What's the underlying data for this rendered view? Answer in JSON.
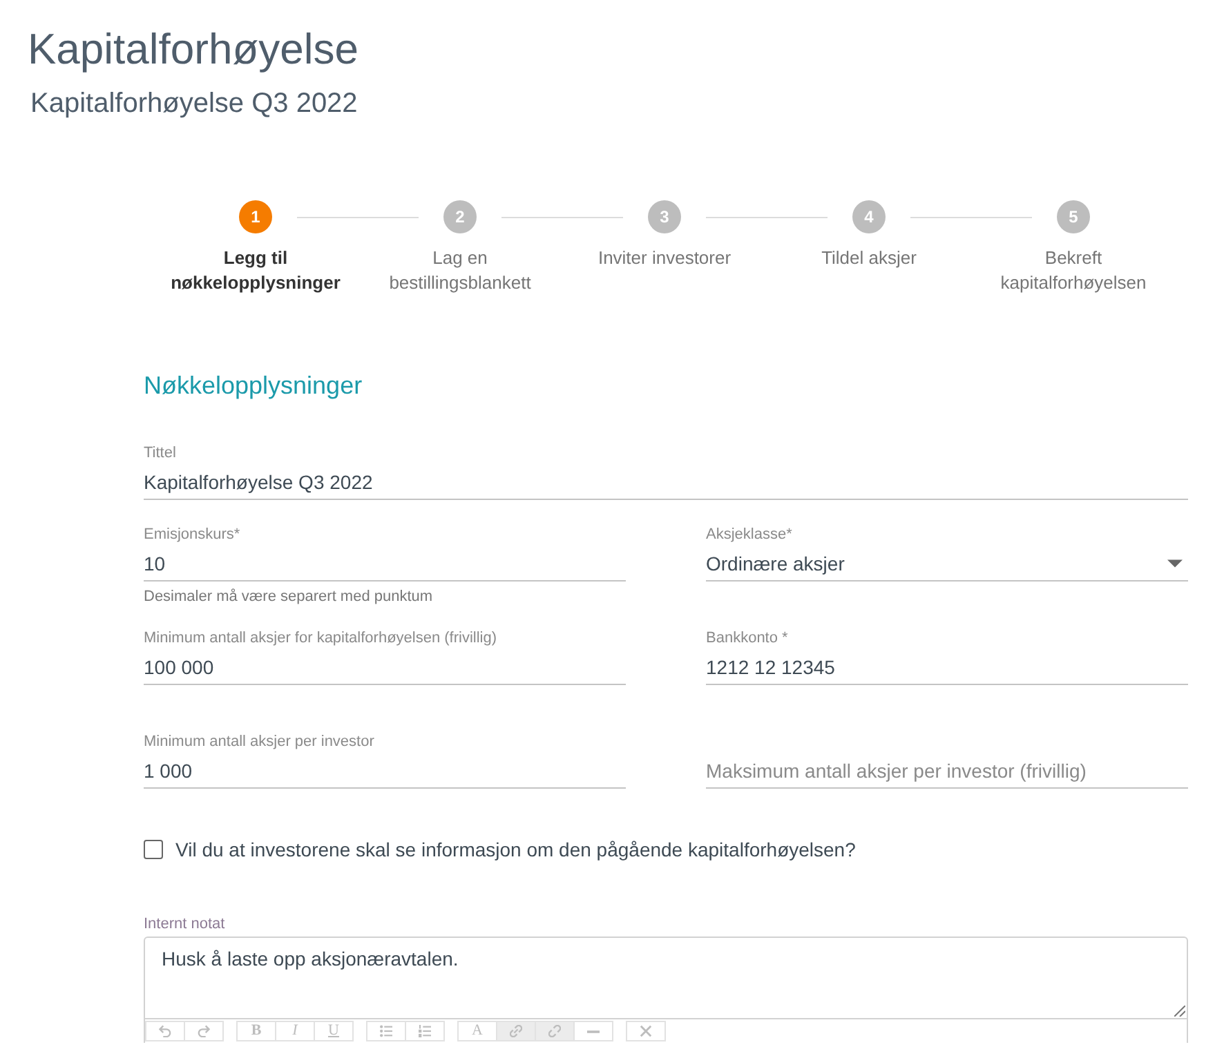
{
  "page": {
    "title": "Kapitalforhøyelse",
    "subtitle": "Kapitalforhøyelse Q3 2022"
  },
  "steps": [
    {
      "number": "1",
      "label": "Legg til nøkkelopplysninger",
      "selected": true
    },
    {
      "number": "2",
      "label": "Lag en bestillingsblankett",
      "selected": false
    },
    {
      "number": "3",
      "label": "Inviter investorer",
      "selected": false
    },
    {
      "number": "4",
      "label": "Tildel aksjer",
      "selected": false
    },
    {
      "number": "5",
      "label": "Bekreft kapitalforhøyelsen",
      "selected": false
    }
  ],
  "section": {
    "title": "Nøkkelopplysninger"
  },
  "form_rows": [
    {
      "fields": [
        {
          "kind": "text",
          "label": "Tittel",
          "value": "Kapitalforhøyelse Q3 2022"
        }
      ]
    },
    {
      "fields": [
        {
          "kind": "text",
          "label": "Emisjonskurs*",
          "value": "10",
          "helper": "Desimaler må være separert med punktum"
        },
        {
          "kind": "select",
          "label": "Aksjeklasse*",
          "value": "Ordinære aksjer"
        }
      ]
    },
    {
      "fields": [
        {
          "kind": "text",
          "label": "Minimum antall aksjer for kapitalforhøyelsen (frivillig)",
          "value": "100 000"
        },
        {
          "kind": "text",
          "label": "Bankkonto *",
          "value": "1212 12 12345"
        }
      ]
    },
    {
      "fields": [
        {
          "kind": "text",
          "label": "Minimum antall aksjer per investor",
          "value": "1 000"
        },
        {
          "kind": "text",
          "placeholder": "Maksimum antall aksjer per investor (frivillig)"
        }
      ]
    }
  ],
  "checkbox": {
    "label": "Vil du at investorene skal se informasjon om den pågående kapitalforhøyelsen?",
    "checked": false
  },
  "note": {
    "label": "Internt notat",
    "value": "Husk å laste opp aksjonæravtalen.",
    "toolbar": [
      {
        "buttons": [
          {
            "kind": "undo",
            "disabled": false
          },
          {
            "kind": "redo",
            "disabled": false
          }
        ]
      },
      {
        "buttons": [
          {
            "kind": "bold",
            "label": "B",
            "disabled": false
          },
          {
            "kind": "italic",
            "label": "I",
            "disabled": false
          },
          {
            "kind": "underline",
            "label": "U",
            "disabled": false
          }
        ]
      },
      {
        "buttons": [
          {
            "kind": "bullet-list",
            "disabled": false
          },
          {
            "kind": "numbered-list",
            "disabled": false
          }
        ]
      },
      {
        "buttons": [
          {
            "kind": "font-color",
            "label": "A",
            "disabled": false
          },
          {
            "kind": "link",
            "disabled": true
          },
          {
            "kind": "unlink",
            "disabled": true
          },
          {
            "kind": "horizontal-rule",
            "disabled": false
          }
        ]
      },
      {
        "buttons": [
          {
            "kind": "clear",
            "disabled": false
          }
        ]
      }
    ]
  }
}
